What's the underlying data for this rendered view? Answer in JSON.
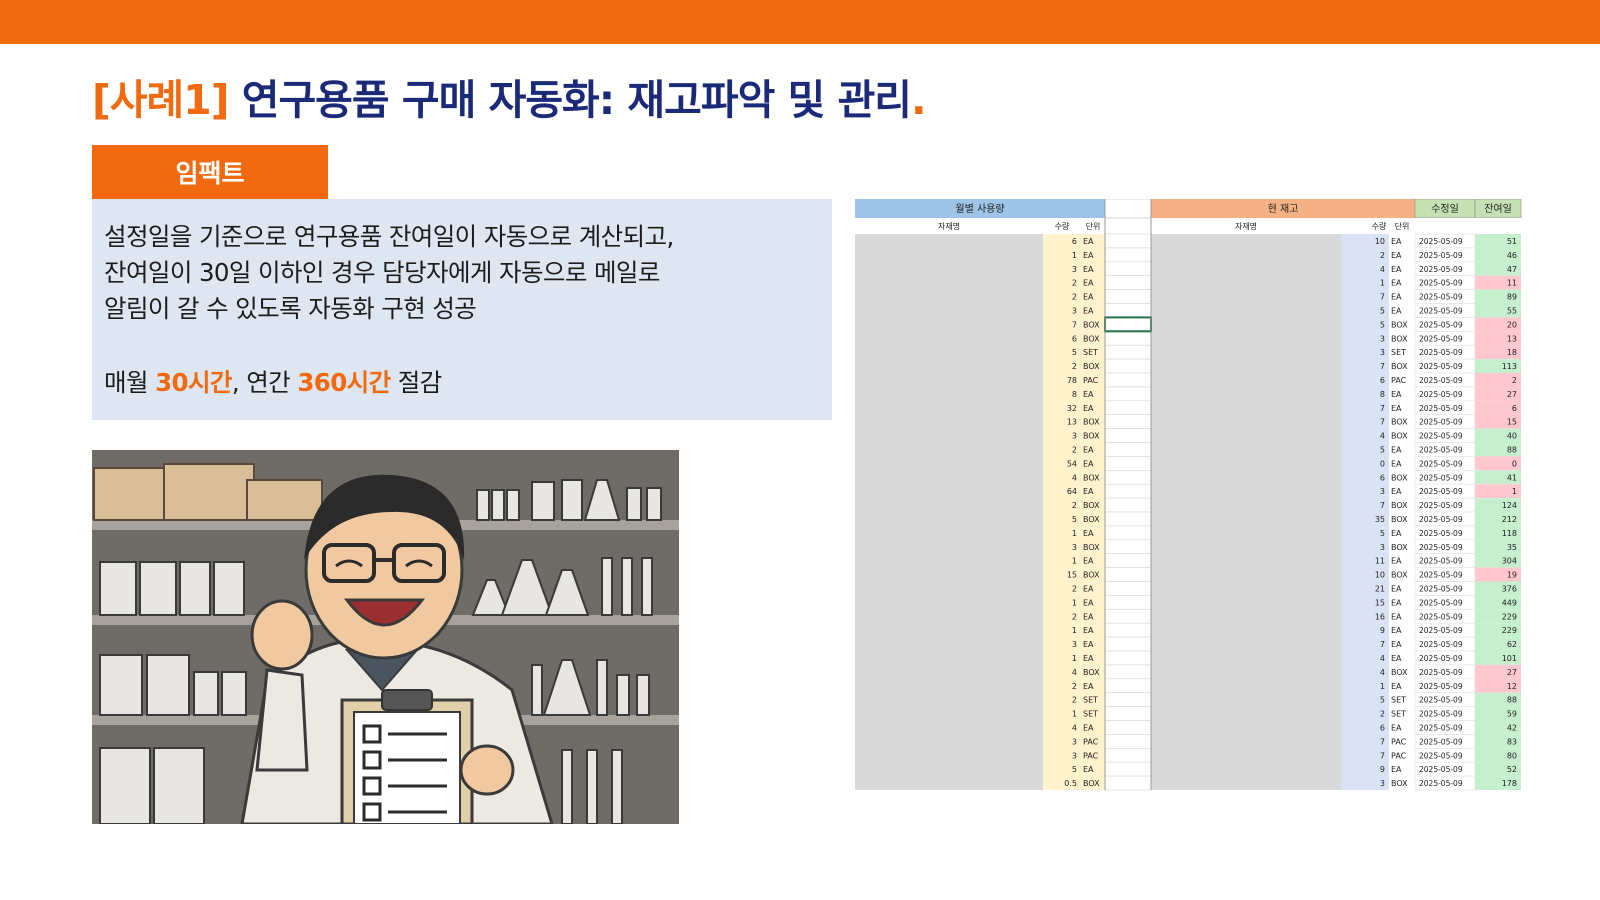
{
  "slide": {
    "title_tag": "[사례1]",
    "title_main": " 연구용품 구매 자동화: 재고파악 및 관리",
    "title_dot": "."
  },
  "impact": {
    "label": "임팩트",
    "line1": "설정일을 기준으로 연구용품 잔여일이 자동으로 계산되고,",
    "line2": "잔여일이 30일 이하인 경우 담당자에게 자동으로 메일로",
    "line3": "알림이 갈 수 있도록 자동화 구현 성공",
    "saving_prefix": "매월 ",
    "saving_month": "30시간",
    "saving_mid": ", 연간 ",
    "saving_year": "360시간",
    "saving_suffix": " 절감"
  },
  "sheet": {
    "monthly_header": "월별 사용량",
    "stock_header": "현 재고",
    "date_header": "수정일",
    "remain_header": "잔여일",
    "col_item": "자재명",
    "col_qty": "수량",
    "col_unit": "단위",
    "monthly_rows": [
      [
        "6",
        "EA"
      ],
      [
        "1",
        "EA"
      ],
      [
        "3",
        "EA"
      ],
      [
        "2",
        "EA"
      ],
      [
        "2",
        "EA"
      ],
      [
        "3",
        "EA"
      ],
      [
        "7",
        "BOX"
      ],
      [
        "6",
        "BOX"
      ],
      [
        "5",
        "SET"
      ],
      [
        "2",
        "BOX"
      ],
      [
        "78",
        "PAC"
      ],
      [
        "8",
        "EA"
      ],
      [
        "32",
        "EA"
      ],
      [
        "13",
        "BOX"
      ],
      [
        "3",
        "BOX"
      ],
      [
        "2",
        "EA"
      ],
      [
        "54",
        "EA"
      ],
      [
        "4",
        "BOX"
      ],
      [
        "64",
        "EA"
      ],
      [
        "2",
        "BOX"
      ],
      [
        "5",
        "BOX"
      ],
      [
        "1",
        "EA"
      ],
      [
        "3",
        "BOX"
      ],
      [
        "1",
        "EA"
      ],
      [
        "15",
        "BOX"
      ],
      [
        "2",
        "EA"
      ],
      [
        "1",
        "EA"
      ],
      [
        "2",
        "EA"
      ],
      [
        "1",
        "EA"
      ],
      [
        "3",
        "EA"
      ],
      [
        "1",
        "EA"
      ],
      [
        "4",
        "BOX"
      ],
      [
        "2",
        "EA"
      ],
      [
        "2",
        "SET"
      ],
      [
        "1",
        "SET"
      ],
      [
        "4",
        "EA"
      ],
      [
        "3",
        "PAC"
      ],
      [
        "3",
        "PAC"
      ],
      [
        "5",
        "EA"
      ],
      [
        "0.5",
        "BOX"
      ]
    ],
    "stock_rows": [
      [
        "10",
        "EA",
        "2025-05-09",
        "51"
      ],
      [
        "2",
        "EA",
        "2025-05-09",
        "46"
      ],
      [
        "4",
        "EA",
        "2025-05-09",
        "47"
      ],
      [
        "1",
        "EA",
        "2025-05-09",
        "11"
      ],
      [
        "7",
        "EA",
        "2025-05-09",
        "89"
      ],
      [
        "5",
        "EA",
        "2025-05-09",
        "55"
      ],
      [
        "5",
        "BOX",
        "2025-05-09",
        "20"
      ],
      [
        "3",
        "BOX",
        "2025-05-09",
        "13"
      ],
      [
        "3",
        "SET",
        "2025-05-09",
        "18"
      ],
      [
        "7",
        "BOX",
        "2025-05-09",
        "113"
      ],
      [
        "6",
        "PAC",
        "2025-05-09",
        "2"
      ],
      [
        "8",
        "EA",
        "2025-05-09",
        "27"
      ],
      [
        "7",
        "EA",
        "2025-05-09",
        "6"
      ],
      [
        "7",
        "BOX",
        "2025-05-09",
        "15"
      ],
      [
        "4",
        "BOX",
        "2025-05-09",
        "40"
      ],
      [
        "5",
        "EA",
        "2025-05-09",
        "88"
      ],
      [
        "0",
        "EA",
        "2025-05-09",
        "0"
      ],
      [
        "6",
        "BOX",
        "2025-05-09",
        "41"
      ],
      [
        "3",
        "EA",
        "2025-05-09",
        "1"
      ],
      [
        "7",
        "BOX",
        "2025-05-09",
        "124"
      ],
      [
        "35",
        "BOX",
        "2025-05-09",
        "212"
      ],
      [
        "5",
        "EA",
        "2025-05-09",
        "118"
      ],
      [
        "3",
        "BOX",
        "2025-05-09",
        "35"
      ],
      [
        "11",
        "EA",
        "2025-05-09",
        "304"
      ],
      [
        "10",
        "BOX",
        "2025-05-09",
        "19"
      ],
      [
        "21",
        "EA",
        "2025-05-09",
        "376"
      ],
      [
        "15",
        "EA",
        "2025-05-09",
        "449"
      ],
      [
        "16",
        "EA",
        "2025-05-09",
        "229"
      ],
      [
        "9",
        "EA",
        "2025-05-09",
        "229"
      ],
      [
        "7",
        "EA",
        "2025-05-09",
        "62"
      ],
      [
        "4",
        "EA",
        "2025-05-09",
        "101"
      ],
      [
        "4",
        "BOX",
        "2025-05-09",
        "27"
      ],
      [
        "1",
        "EA",
        "2025-05-09",
        "12"
      ],
      [
        "5",
        "SET",
        "2025-05-09",
        "88"
      ],
      [
        "2",
        "SET",
        "2025-05-09",
        "59"
      ],
      [
        "6",
        "EA",
        "2025-05-09",
        "42"
      ],
      [
        "7",
        "PAC",
        "2025-05-09",
        "83"
      ],
      [
        "7",
        "PAC",
        "2025-05-09",
        "80"
      ],
      [
        "9",
        "EA",
        "2025-05-09",
        "52"
      ],
      [
        "3",
        "BOX",
        "2025-05-09",
        "178"
      ]
    ],
    "colors": {
      "monthly_header_bg": "#9dc3e6",
      "stock_header_bg": "#f4b183",
      "date_header_bg": "#c6e0b4",
      "qty_bg_monthly": "#fff2cc",
      "qty_bg_stock": "#dae3f3",
      "item_bg": "#d9d9d9",
      "remain_ok": "#c6efce",
      "remain_low": "#ffc7ce"
    }
  }
}
